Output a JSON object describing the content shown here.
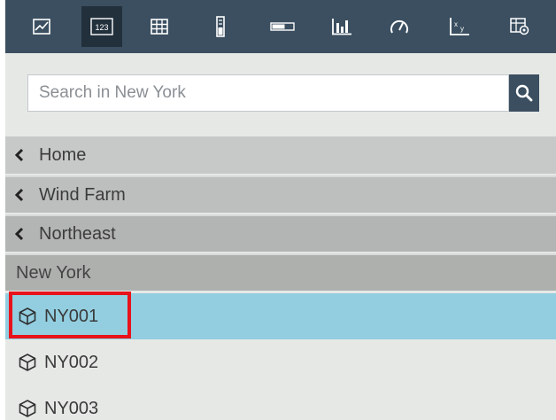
{
  "toolbar": {
    "buttons": [
      {
        "icon": "line-chart-icon",
        "active": false
      },
      {
        "icon": "numeric-123-icon",
        "label": "123",
        "active": true
      },
      {
        "icon": "grid-table-icon",
        "active": false
      },
      {
        "icon": "vertical-gauge-icon",
        "active": false
      },
      {
        "icon": "horizontal-gauge-icon",
        "active": false
      },
      {
        "icon": "bar-chart-icon",
        "active": false
      },
      {
        "icon": "dial-gauge-icon",
        "active": false
      },
      {
        "icon": "xy-plot-icon",
        "active": false
      },
      {
        "icon": "table-settings-icon",
        "active": false
      }
    ],
    "background": "#3b4f60",
    "active_background": "#22303c"
  },
  "search": {
    "placeholder": "Search in New York",
    "value": "",
    "button_icon": "search-icon"
  },
  "breadcrumbs": [
    {
      "label": "Home",
      "icon": "chevron-left-icon"
    },
    {
      "label": "Wind Farm",
      "icon": "chevron-left-icon"
    },
    {
      "label": "Northeast",
      "icon": "chevron-left-icon"
    }
  ],
  "current_location": "New York",
  "items": [
    {
      "label": "NY001",
      "icon": "cube-icon",
      "selected": true
    },
    {
      "label": "NY002",
      "icon": "cube-icon",
      "selected": false
    },
    {
      "label": "NY003",
      "icon": "cube-icon",
      "selected": false
    }
  ],
  "colors": {
    "selected_row": "#92cee0",
    "highlight_border": "#e8121b",
    "panel_background": "#e6e8e6"
  }
}
